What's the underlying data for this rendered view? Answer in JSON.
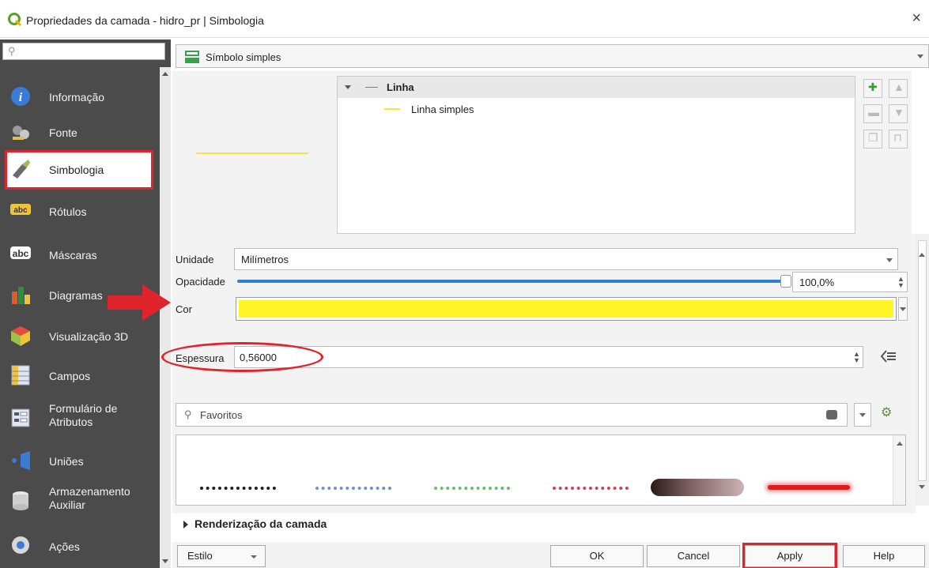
{
  "window": {
    "title": "Propriedades da camada - hidro_pr | Simbologia",
    "close_glyph": "×"
  },
  "sidebar": {
    "search_placeholder": "",
    "items": [
      {
        "label": "Informação",
        "icon": "info-icon"
      },
      {
        "label": "Fonte",
        "icon": "source-icon"
      },
      {
        "label": "Simbologia",
        "icon": "symbology-icon",
        "active": true
      },
      {
        "label": "Rótulos",
        "icon": "labels-icon"
      },
      {
        "label": "Máscaras",
        "icon": "masks-icon"
      },
      {
        "label": "Diagramas",
        "icon": "diagrams-icon"
      },
      {
        "label": "Visualização 3D",
        "icon": "3d-view-icon"
      },
      {
        "label": "Campos",
        "icon": "fields-icon"
      },
      {
        "label": "Formulário de Atributos",
        "icon": "attribute-form-icon"
      },
      {
        "label": "Uniões",
        "icon": "joins-icon"
      },
      {
        "label": "Armazenamento Auxiliar",
        "icon": "auxiliary-storage-icon"
      },
      {
        "label": "Ações",
        "icon": "actions-icon"
      }
    ]
  },
  "renderer": {
    "selected": "Símbolo simples"
  },
  "symbol_tree": {
    "root": "Linha",
    "child": "Linha simples"
  },
  "properties": {
    "unit_label": "Unidade",
    "unit_value": "Milímetros",
    "opacity_label": "Opacidade",
    "opacity_value": "100,0%",
    "opacity_fraction": 1.0,
    "color_label": "Cor",
    "color_hex": "#fff426",
    "width_label": "Espessura",
    "width_value": "0,56000"
  },
  "library": {
    "search_value": "Favoritos"
  },
  "render_section": {
    "label": "Renderização da camada"
  },
  "buttons": {
    "style": "Estilo",
    "ok": "OK",
    "cancel": "Cancel",
    "apply": "Apply",
    "help": "Help"
  },
  "colors": {
    "accent_red": "#e0242b",
    "sidebar_bg": "#4b4b4b",
    "slider_blue": "#2f7fd3"
  }
}
